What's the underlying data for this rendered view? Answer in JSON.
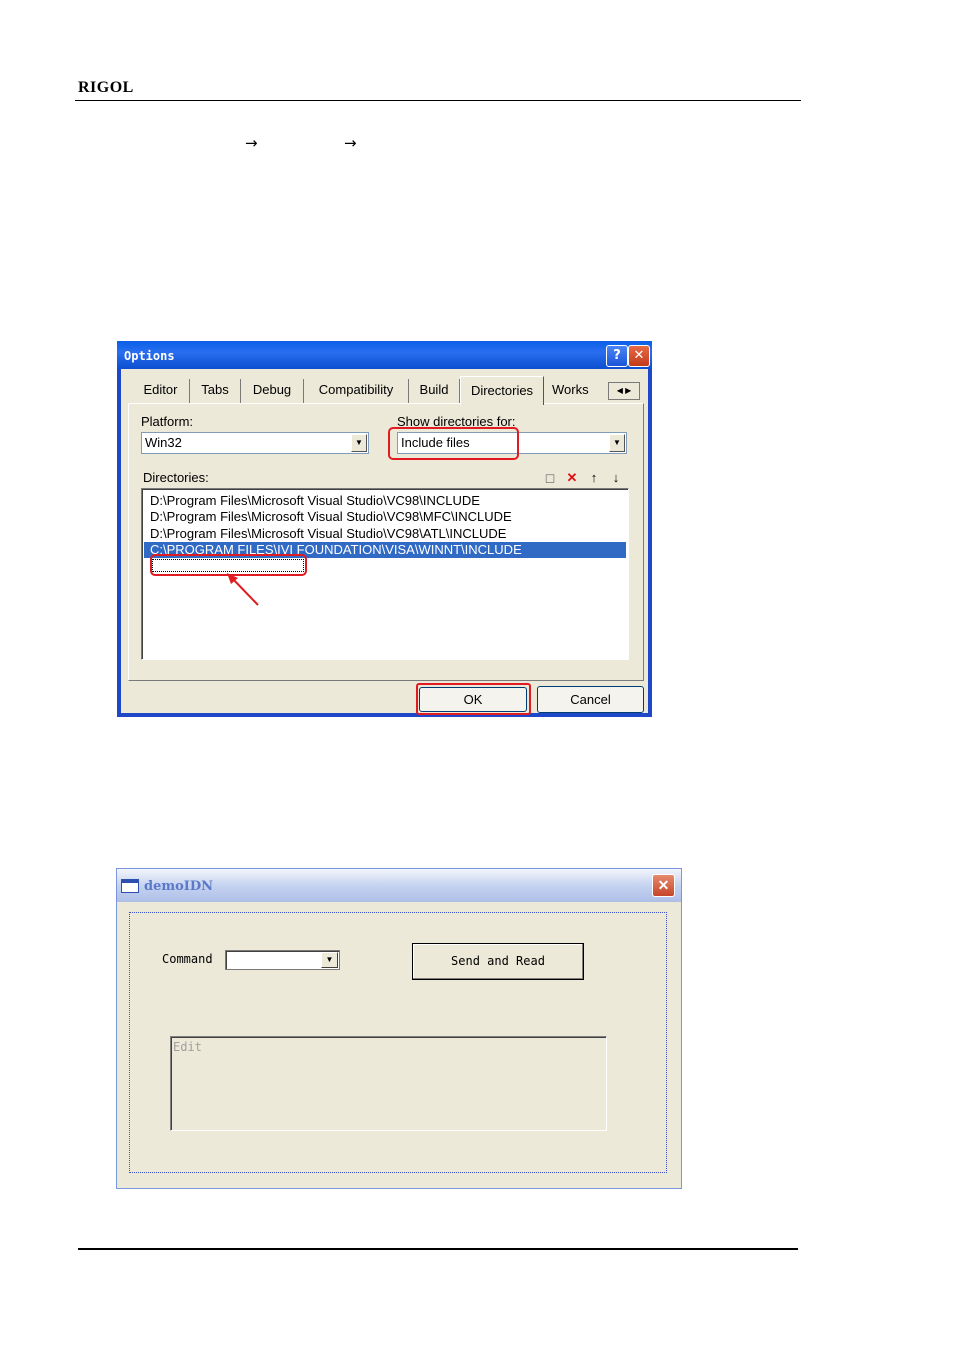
{
  "header": {
    "brand": "RIGOL"
  },
  "options_dialog": {
    "title": "Options",
    "tabs": [
      "Editor",
      "Tabs",
      "Debug",
      "Compatibility",
      "Build",
      "Directories",
      "Works"
    ],
    "selected_tab": "Directories",
    "platform_label": "Platform:",
    "platform_value": "Win32",
    "show_dirs_label": "Show directories for:",
    "show_dirs_value": "Include files",
    "directories_label": "Directories:",
    "directories": [
      "D:\\Program Files\\Microsoft Visual Studio\\VC98\\INCLUDE",
      "D:\\Program Files\\Microsoft Visual Studio\\VC98\\MFC\\INCLUDE",
      "D:\\Program Files\\Microsoft Visual Studio\\VC98\\ATL\\INCLUDE",
      "C:\\PROGRAM FILES\\IVI FOUNDATION\\VISA\\WINNT\\INCLUDE"
    ],
    "ok_label": "OK",
    "cancel_label": "Cancel"
  },
  "demo_dialog": {
    "title": "demoIDN",
    "command_label": "Command",
    "send_button": "Send and Read",
    "edit_placeholder": "Edit"
  }
}
